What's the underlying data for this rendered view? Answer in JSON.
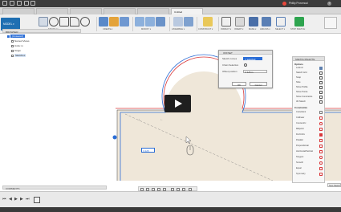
{
  "topbar": {
    "user": "Phillip Provencal"
  },
  "tabs": [
    {
      "label": ""
    },
    {
      "label": ""
    },
    {
      "label": ""
    },
    {
      "label": ""
    },
    {
      "label": ""
    },
    {
      "label": "Untitled"
    }
  ],
  "ribbon": {
    "workspace": "MODEL",
    "groups": [
      {
        "label": "SKETCH ▾"
      },
      {
        "label": "CREATE ▾"
      },
      {
        "label": "MODIFY ▾"
      },
      {
        "label": "ASSEMBLE ▾"
      },
      {
        "label": "CONSTRUCT ▾"
      },
      {
        "label": "INSPECT ▾"
      },
      {
        "label": "INSERT ▾"
      },
      {
        "label": "MAKE ▾"
      },
      {
        "label": "ADD-INS ▾"
      },
      {
        "label": "SELECT ▾"
      },
      {
        "label": "STOP SKETCH"
      }
    ]
  },
  "browser": {
    "title": "BROWSER",
    "items": [
      {
        "label": "(Unsaved)"
      },
      {
        "label": "Named Views"
      },
      {
        "label": "Units: in"
      },
      {
        "label": "Origin"
      },
      {
        "label": "Sketches"
      }
    ]
  },
  "offset_dialog": {
    "title": "OFFSET",
    "rows": [
      {
        "label": "Sketch curves",
        "value": "1 selected"
      },
      {
        "label": "Chain Selection",
        "value": ""
      },
      {
        "label": "Offset position",
        "value": "0.125 in"
      }
    ],
    "ok": "OK",
    "cancel": "Cancel"
  },
  "palette": {
    "title": "SKETCH PALETTE",
    "options_title": "Options",
    "options": [
      {
        "label": "Look At"
      },
      {
        "label": "Sketch Grid"
      },
      {
        "label": "Snap"
      },
      {
        "label": "Slice"
      },
      {
        "label": "Show Profile"
      },
      {
        "label": "Show Points"
      },
      {
        "label": "Show Constraints"
      },
      {
        "label": "3D Sketch"
      }
    ],
    "constraints_title": "Constraints",
    "constraints": [
      {
        "label": "Coincident"
      },
      {
        "label": "Collinear"
      },
      {
        "label": "Concentric"
      },
      {
        "label": "Midpoint"
      },
      {
        "label": "Fix/UnFix"
      },
      {
        "label": "Parallel"
      },
      {
        "label": "Perpendicular"
      },
      {
        "label": "Horizontal/Vertical"
      },
      {
        "label": "Tangent"
      },
      {
        "label": "Smooth"
      },
      {
        "label": "Equal"
      },
      {
        "label": "Symmetry"
      }
    ],
    "stop_sketch": "Stop Sketch"
  },
  "dimension": {
    "value": "0.125"
  },
  "comments": {
    "label": "COMMENTS"
  },
  "statusbar": {
    "text": ""
  },
  "colors": {
    "profile_fill": "#efe7d9",
    "offset_red": "#d9383a",
    "offset_blue": "#2f6fd6",
    "accent": "#1f6fb2"
  }
}
